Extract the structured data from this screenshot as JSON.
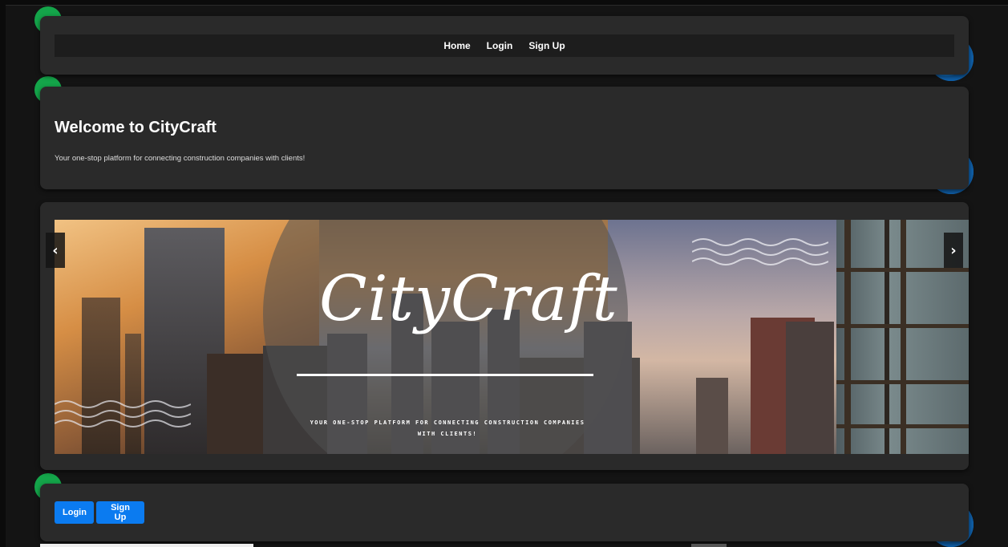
{
  "nav": {
    "links": [
      "Home",
      "Login",
      "Sign Up"
    ]
  },
  "welcome": {
    "title": "Welcome to CityCraft",
    "subtitle": "Your one-stop platform for connecting construction companies with clients!"
  },
  "carousel": {
    "slide_logo": "CityCraft",
    "slide_tagline": "YOUR ONE-STOP PLATFORM FOR CONNECTING CONSTRUCTION COMPANIES WITH CLIENTS!",
    "prev_icon": "chevron-left-icon",
    "next_icon": "chevron-right-icon",
    "prev_glyph": "‹",
    "next_glyph": "›"
  },
  "actions": {
    "login_label": "Login",
    "signup_label": "Sign Up"
  },
  "colors": {
    "background": "#141414",
    "card": "#2a2a2a",
    "primary_button": "#0b7bf0",
    "deco_green": "#14a54a",
    "deco_blue": "#1576c9"
  }
}
